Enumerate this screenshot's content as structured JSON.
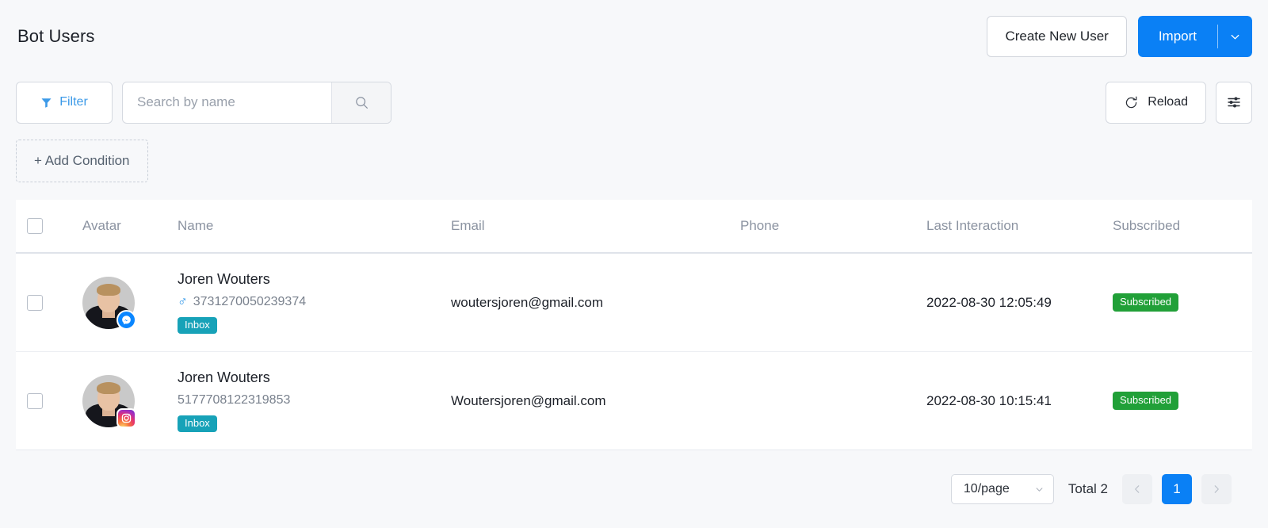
{
  "header": {
    "title": "Bot Users",
    "create_button": "Create New User",
    "import_button": "Import",
    "import_caret_icon": "chevron-down-icon"
  },
  "toolbar": {
    "filter_button": "Filter",
    "filter_icon": "funnel-icon",
    "search_placeholder": "Search by name",
    "search_value": "",
    "search_icon": "search-icon",
    "reload_button": "Reload",
    "reload_icon": "refresh-icon",
    "settings_icon": "sliders-icon",
    "add_condition_button": "+ Add Condition"
  },
  "table": {
    "columns": [
      {
        "key": "checkbox",
        "label": ""
      },
      {
        "key": "avatar",
        "label": "Avatar"
      },
      {
        "key": "name",
        "label": "Name"
      },
      {
        "key": "email",
        "label": "Email"
      },
      {
        "key": "phone",
        "label": "Phone"
      },
      {
        "key": "last_interaction",
        "label": "Last Interaction"
      },
      {
        "key": "subscribed",
        "label": "Subscribed"
      }
    ],
    "rows": [
      {
        "name": "Joren Wouters",
        "gender_icon": "male-icon",
        "user_id": "3731270050239374",
        "tag": "Inbox",
        "email": "woutersjoren@gmail.com",
        "phone": "",
        "last_interaction": "2022-08-30 12:05:49",
        "subscribed": "Subscribed",
        "channel_icon": "messenger-icon"
      },
      {
        "name": "Joren Wouters",
        "gender_icon": "",
        "user_id": "5177708122319853",
        "tag": "Inbox",
        "email": "Woutersjoren@gmail.com",
        "phone": "",
        "last_interaction": "2022-08-30 10:15:41",
        "subscribed": "Subscribed",
        "channel_icon": "instagram-icon"
      }
    ]
  },
  "pagination": {
    "page_size": "10/page",
    "page_size_caret_icon": "chevron-down-icon",
    "total": "Total 2",
    "prev_icon": "chevron-left-icon",
    "next_icon": "chevron-right-icon",
    "current_page": "1"
  },
  "colors": {
    "primary": "#0a80f5",
    "link": "#3c9ae8",
    "tag_inbox": "#17a2b8",
    "badge_subscribed": "#21a038",
    "page_bg": "#f7f8fa"
  }
}
